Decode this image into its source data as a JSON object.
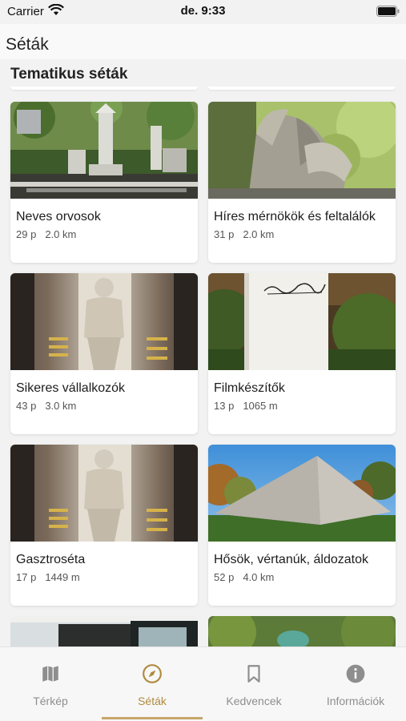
{
  "status_bar": {
    "carrier": "Carrier",
    "time": "de. 9:33"
  },
  "nav": {
    "title": "Séták"
  },
  "section": {
    "title": "Tematikus séták"
  },
  "walks": [
    {
      "title": "Neves orvosok",
      "duration": "29 p",
      "distance": "2.0 km",
      "image": "cemetery-monuments"
    },
    {
      "title": "Híres mérnökök és feltalálók",
      "duration": "31 p",
      "distance": "2.0 km",
      "image": "angel-statue"
    },
    {
      "title": "Sikeres vállalkozók",
      "duration": "43 p",
      "distance": "3.0 km",
      "image": "marble-crypt-statue"
    },
    {
      "title": "Filmkészítők",
      "duration": "13 p",
      "distance": "1065 m",
      "image": "white-stele-signature"
    },
    {
      "title": "Gasztroséta",
      "duration": "17 p",
      "distance": "1449 m",
      "image": "marble-crypt-statue"
    },
    {
      "title": "Hősök, vértanúk, áldozatok",
      "duration": "52 p",
      "distance": "4.0 km",
      "image": "pyramid-memorial"
    }
  ],
  "tabs": [
    {
      "label": "Térkép",
      "icon": "map-icon",
      "active": false
    },
    {
      "label": "Séták",
      "icon": "compass-icon",
      "active": true
    },
    {
      "label": "Kedvencek",
      "icon": "bookmark-icon",
      "active": false
    },
    {
      "label": "Információk",
      "icon": "info-icon",
      "active": false
    }
  ],
  "colors": {
    "accent": "#b08a3e",
    "tab_inactive": "#8e8e8e",
    "background": "#f2f2f2"
  }
}
